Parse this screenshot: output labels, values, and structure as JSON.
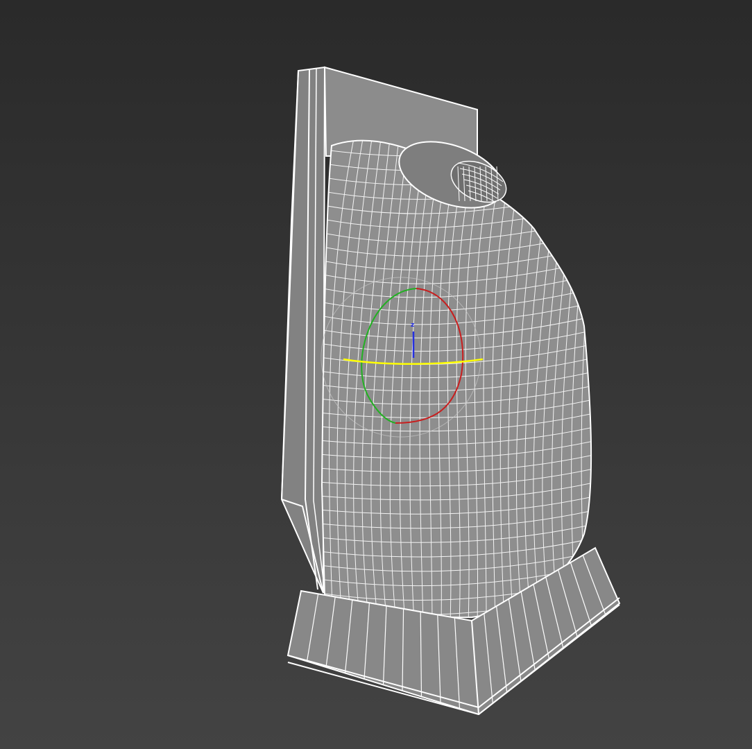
{
  "viewport": {
    "shading_mode": "wireframe",
    "background_top": "#2a2a2a",
    "background_bottom": "#434343"
  },
  "colors": {
    "wire": "#ffffff",
    "surface_dark": "#7c7c7c",
    "surface_mid": "#8e8e8e",
    "surface_light": "#9a9a9a",
    "gizmo_x": "#c81e1e",
    "gizmo_y": "#22b022",
    "gizmo_z": "#2530e0",
    "gizmo_view": "#ffff00",
    "gizmo_screen": "#c8c8c8"
  },
  "gizmo": {
    "tool": "rotate",
    "axis_label": "z"
  },
  "model": {
    "name": "object-with-stand",
    "parts": [
      "back-panel",
      "front-frame",
      "curved-shell",
      "top-opening",
      "base-stand"
    ]
  }
}
